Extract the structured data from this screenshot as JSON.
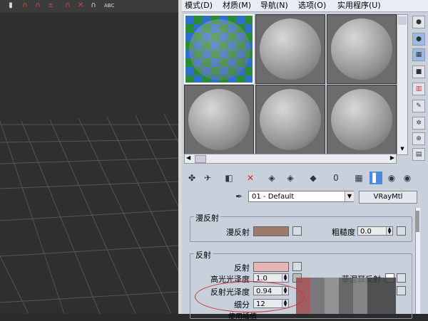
{
  "menu": [
    "模式(D)",
    "材质(M)",
    "导航(N)",
    "选项(O)",
    "实用程序(U)"
  ],
  "toolbar": {
    "abc_label": "ABC"
  },
  "material": {
    "name": "01 - Default",
    "type": "VRayMtl"
  },
  "diffuse": {
    "group": "漫反射",
    "label": "漫反射",
    "color": "#9b7a6c",
    "roughness_label": "粗糙度",
    "roughness": "0.0"
  },
  "reflect": {
    "group": "反射",
    "label": "反射",
    "color": "#e6b4b4",
    "hilight_label": "高光光泽度",
    "hilight_value": "1.0",
    "fresnel_label": "菲涅耳反射",
    "gloss_label": "反射光泽度",
    "gloss_value": "0.94",
    "subdiv_label": "细分",
    "subdiv_value": "12",
    "use_interp_label": "使用插值"
  },
  "colors": {
    "accent_red": "#d03030",
    "editor_bg": "#c8d0dc",
    "viewport_bg": "#2f2f2f"
  },
  "icons": [
    "sample-sphere-icon",
    "backlight-icon",
    "background-checker-icon",
    "sample-uv-icon",
    "video-color-icon",
    "make-preview-icon",
    "options-icon",
    "select-by-material-icon",
    "material-navigator-icon"
  ]
}
